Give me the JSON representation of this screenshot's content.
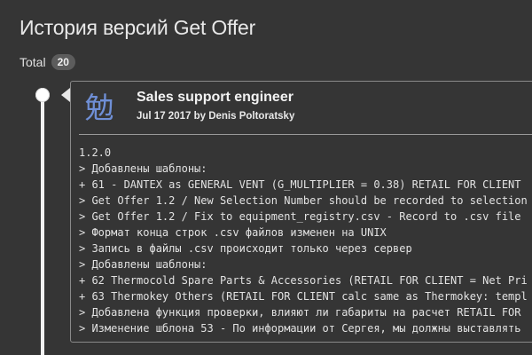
{
  "page": {
    "title": "История версий Get Offer",
    "total_label": "Total",
    "total_count": "20"
  },
  "release": {
    "logo_glyph": "勉",
    "title": "Sales support engineer",
    "meta": "Jul 17 2017 by Denis Poltoratsky",
    "notes": [
      "1.2.0",
      "> Добавлены шаблоны:",
      "+ 61 - DANTEX as GENERAL VENT (G_MULTIPLIER = 0.38) RETAIL FOR CLIENT",
      "> Get Offer 1.2 / New Selection Number should be recorded to selection",
      "> Get Offer 1.2 / Fix to equipment_registry.csv - Record to .csv file",
      "> Формат конца строк .csv файлов изменен на UNIX",
      "> Запись в файлы .csv происходит только через сервер",
      "> Добавлены шаблоны:",
      "+ 62 Thermocold Spare Parts & Accessories (RETAIL FOR CLIENT = Net Pri",
      "+ 63 Thermokey Others (RETAIL FOR CLIENT calc same as Thermokey: templ",
      "> Добавлена функция проверки, влияют ли габариты на расчет RETAIL FOR",
      "> Изменение шблона 53 - По информации от Сергея, мы должны выставлять"
    ]
  },
  "colors": {
    "background": "#353535",
    "logo": "#6f8fd6",
    "timeline": "#f2f2f2"
  }
}
